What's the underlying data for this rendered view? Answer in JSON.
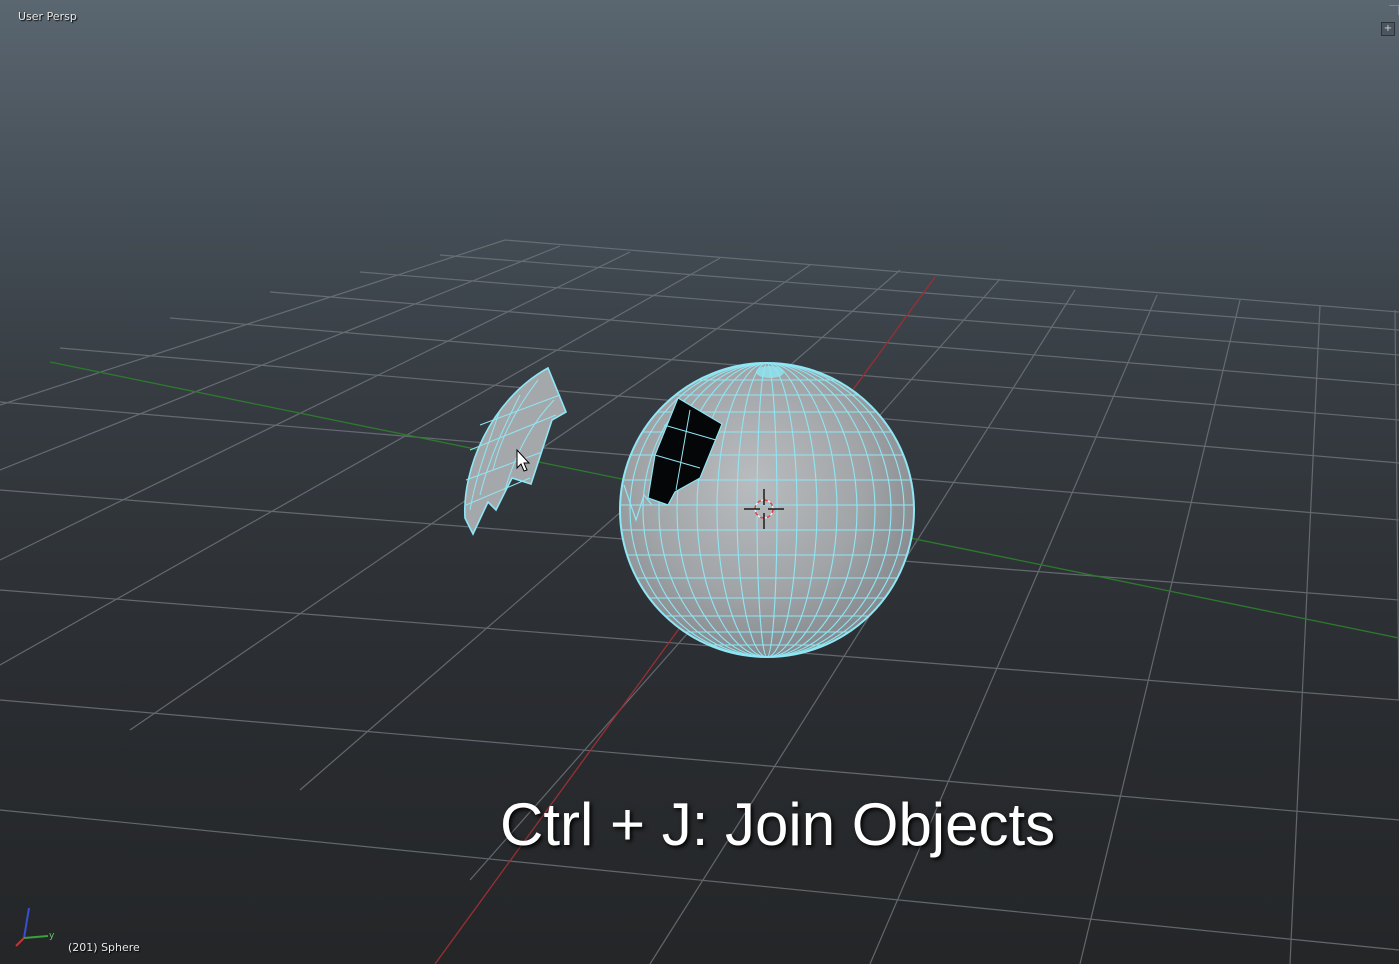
{
  "viewport": {
    "view_label": "User Persp",
    "object_info": "(201) Sphere",
    "caption": "Ctrl + J: Join Objects",
    "corner_button_glyph": "+"
  },
  "axis_gizmo": {
    "y_label": "y"
  },
  "colors": {
    "wire": "#8fe6f4",
    "mesh_fill": "#9ea2a6",
    "grid": "#6d7379",
    "x_axis": "#9a2f34",
    "y_axis": "#2d7a2d"
  }
}
